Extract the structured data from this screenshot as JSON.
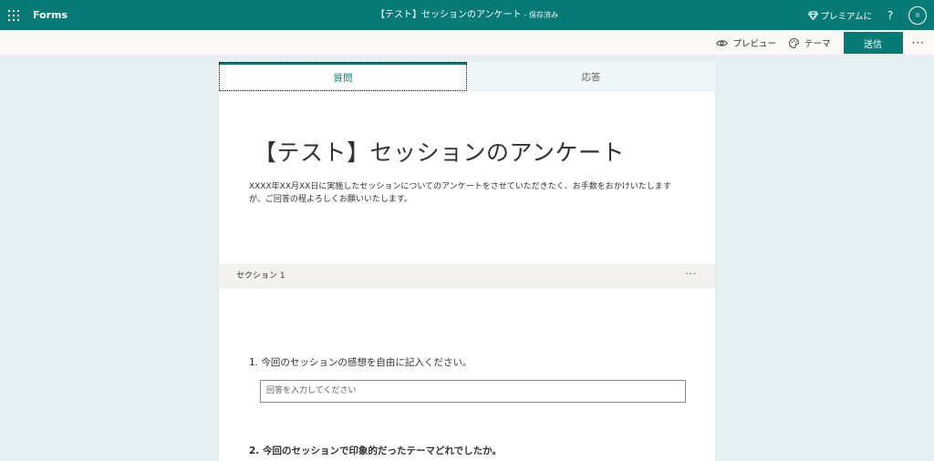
{
  "app": {
    "name": "Forms",
    "doc_title": "【テスト】セッションのアンケート",
    "save_status": "- 保存済み",
    "premium_label": "プレミアムに"
  },
  "header": {
    "help": "?",
    "avatar_initials": "II"
  },
  "toolbar": {
    "preview_label": "プレビュー",
    "theme_label": "テーマ",
    "send_label": "送信",
    "more": "···"
  },
  "tabs": [
    {
      "label": "質問",
      "active": true
    },
    {
      "label": "応答",
      "active": false
    }
  ],
  "form": {
    "title": "【テスト】セッションのアンケート",
    "description": "XXXX年XX月XX日に実施したセッションについてのアンケートをさせていただきたく、お手数をおかけいたしますが、ご回答の程よろしくお願いいたします。",
    "section_label": "セクション 1",
    "section_more": "···",
    "questions": [
      {
        "label": "1. 今回のセッションの感想を自由に記入ください。",
        "placeholder": "回答を入力してください"
      },
      {
        "label": "2. 今回のセッションで印象的だったテーマどれでしたか。"
      }
    ]
  },
  "colors": {
    "brand": "#077a76",
    "background": "#e6f0f2"
  },
  "icons": {
    "app_launcher": "waffle-icon",
    "premium": "diamond-icon",
    "preview": "eye-icon",
    "theme": "palette-icon"
  }
}
